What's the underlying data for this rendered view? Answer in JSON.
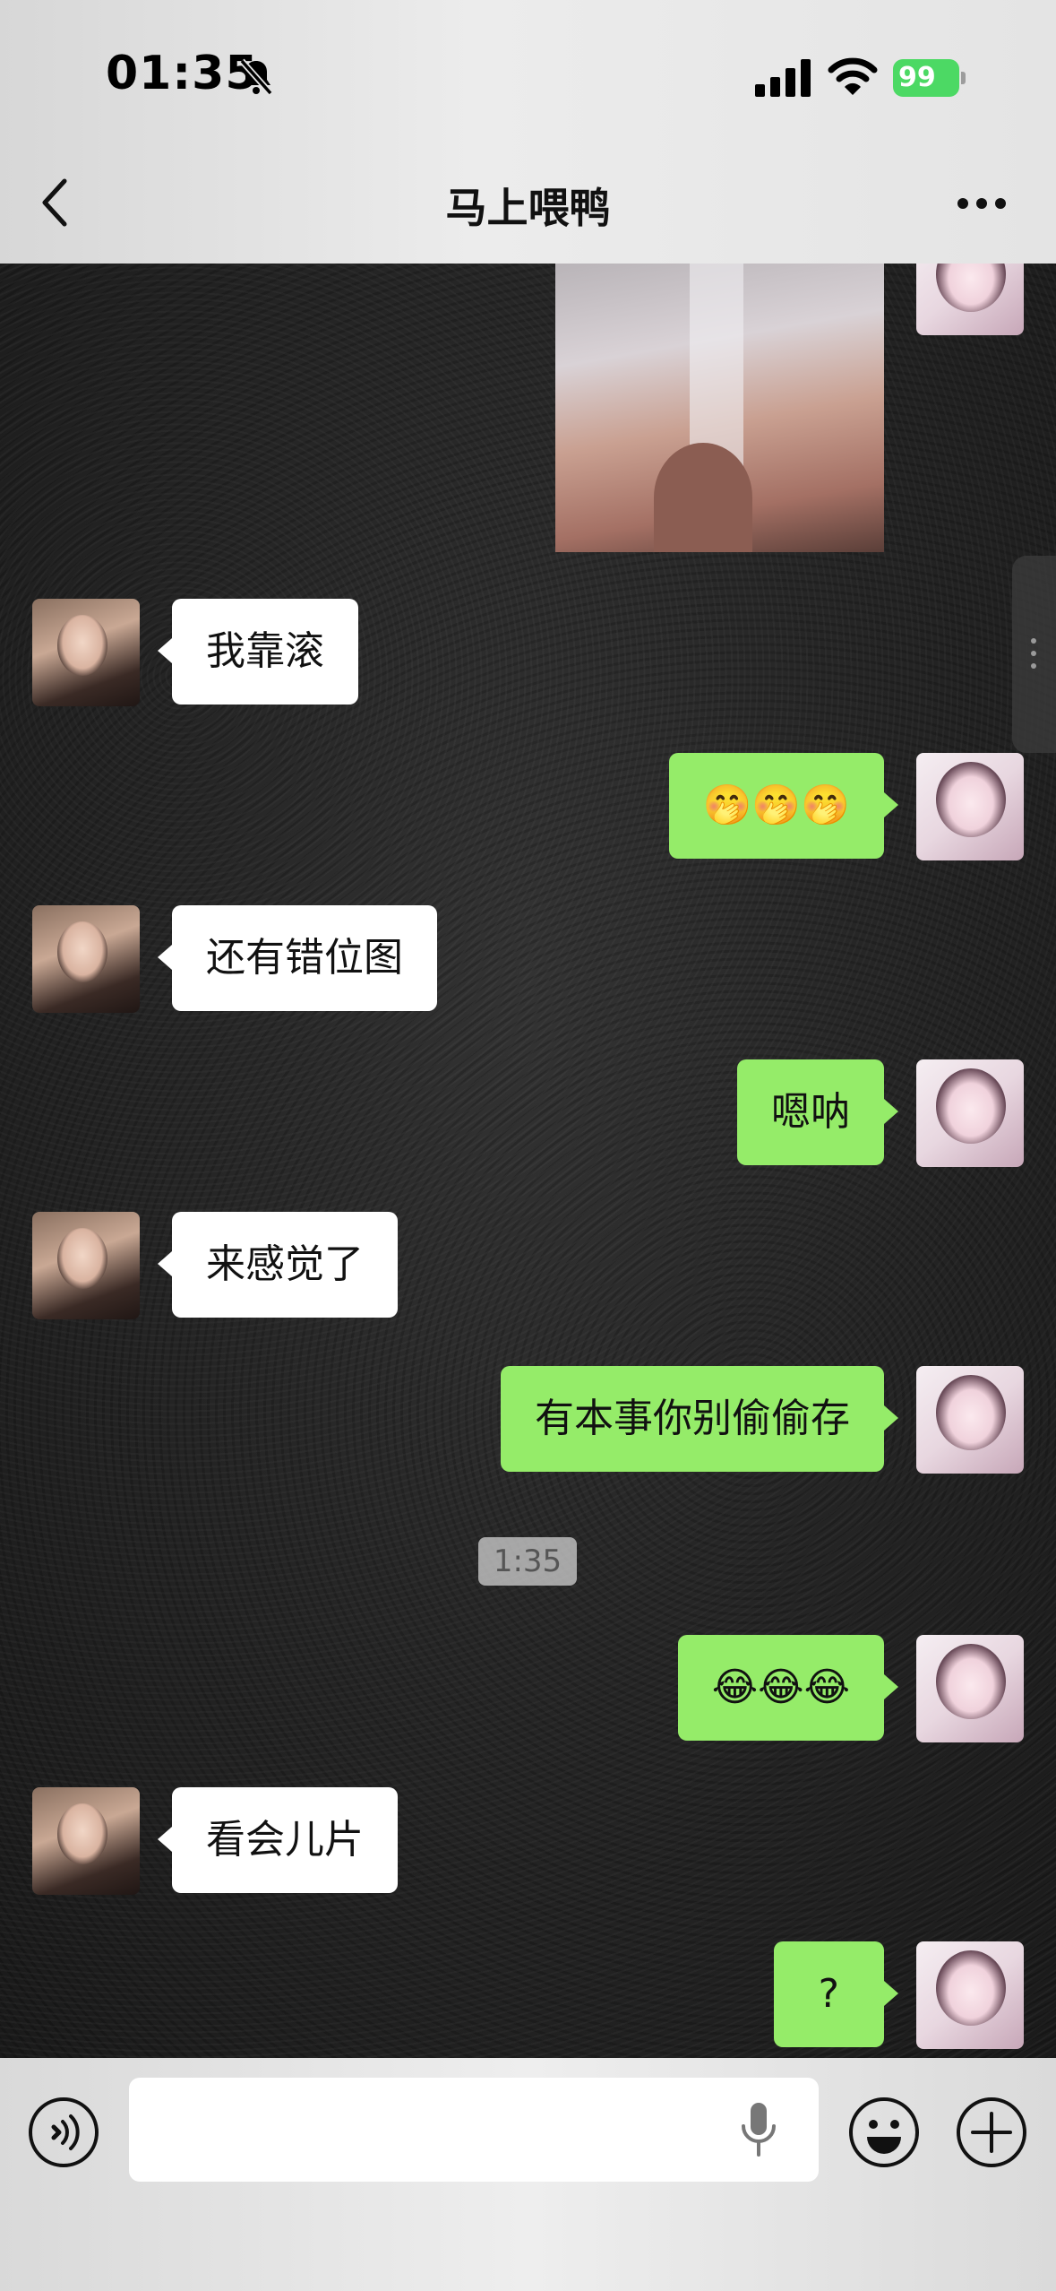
{
  "status_bar": {
    "time": "01:35",
    "battery": "99"
  },
  "header": {
    "title": "马上喂鸭"
  },
  "messages": [
    {
      "side": "right",
      "type": "image"
    },
    {
      "side": "left",
      "type": "text",
      "text": "我靠滚"
    },
    {
      "side": "right",
      "type": "text",
      "text": "🤭🤭🤭"
    },
    {
      "side": "left",
      "type": "text",
      "text": "还有错位图"
    },
    {
      "side": "right",
      "type": "text",
      "text": "嗯呐"
    },
    {
      "side": "left",
      "type": "text",
      "text": "来感觉了"
    },
    {
      "side": "right",
      "type": "text",
      "text": "有本事你别偷偷存"
    },
    {
      "side": "timestamp",
      "text": "1:35"
    },
    {
      "side": "right",
      "type": "text",
      "text": "😂😂😂"
    },
    {
      "side": "left",
      "type": "text",
      "text": "看会儿片"
    },
    {
      "side": "right",
      "type": "text",
      "text": "?"
    }
  ],
  "input_bar": {
    "value": ""
  },
  "icons": {
    "status": [
      "bell-slash-icon",
      "signal-icon",
      "wifi-icon",
      "battery-icon"
    ],
    "header": [
      "back-icon",
      "more-icon"
    ],
    "input": [
      "voice-icon",
      "mic-icon",
      "emoji-icon",
      "plus-icon"
    ]
  },
  "colors": {
    "self_bubble": "#95ec69",
    "other_bubble": "#ffffff",
    "battery": "#4cd964"
  }
}
